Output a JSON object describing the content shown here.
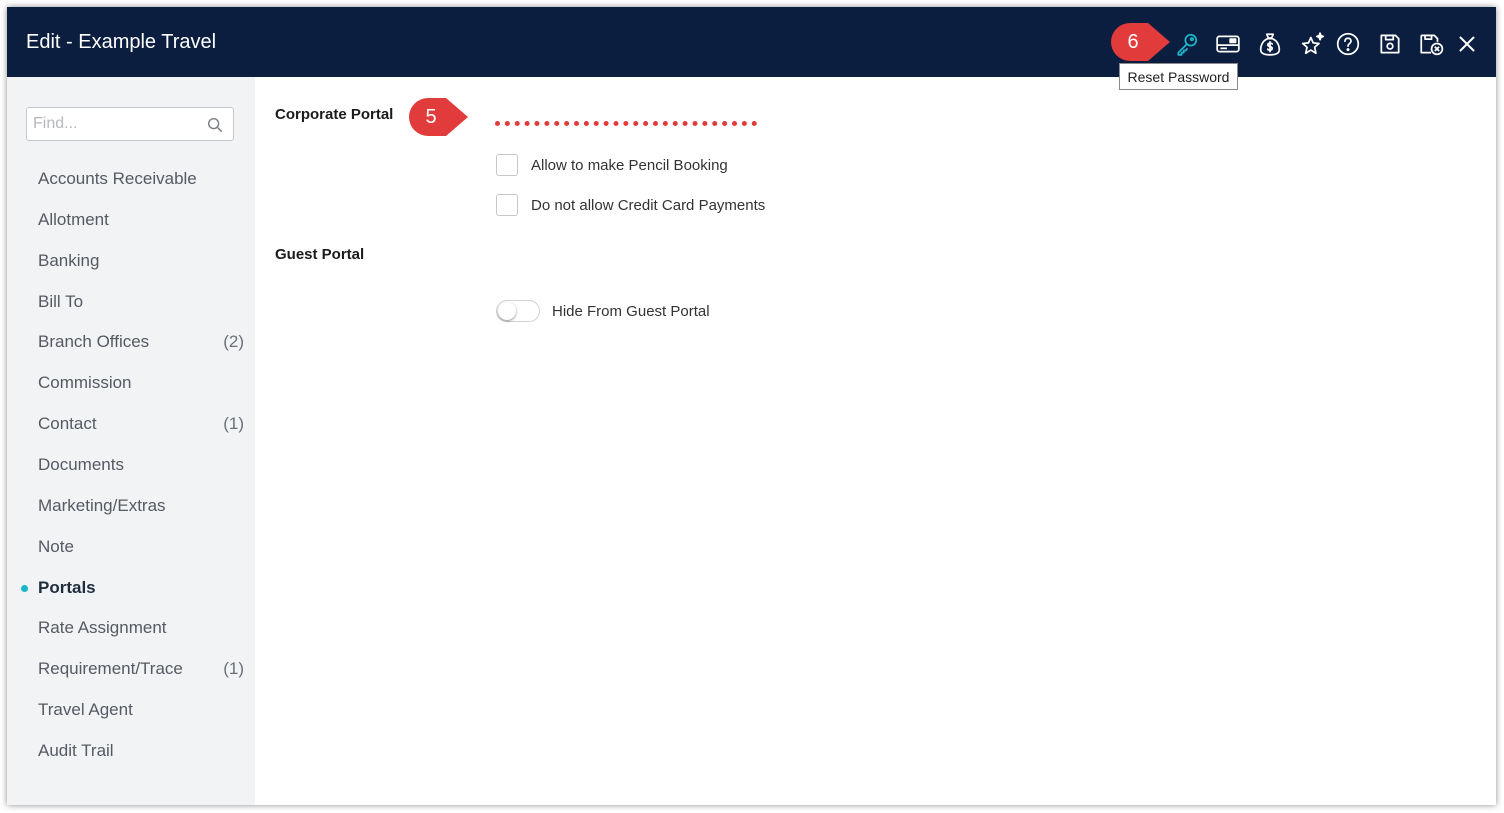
{
  "window": {
    "title": "Edit - Example Travel"
  },
  "toolbar": {
    "icons": [
      {
        "name": "key-icon",
        "tooltip": "Reset Password",
        "color": "#1ab6c9"
      },
      {
        "name": "card-icon"
      },
      {
        "name": "money-bag-icon"
      },
      {
        "name": "stars-icon"
      },
      {
        "name": "help-icon"
      },
      {
        "name": "save-icon"
      },
      {
        "name": "save-close-icon"
      },
      {
        "name": "close-icon"
      }
    ],
    "tooltip": "Reset Password"
  },
  "annotations": {
    "marker_5": "5",
    "marker_6": "6",
    "color": "#e23b3b"
  },
  "sidebar": {
    "search_placeholder": "Find...",
    "items": [
      {
        "label": "Accounts Receivable",
        "count": ""
      },
      {
        "label": "Allotment",
        "count": ""
      },
      {
        "label": "Banking",
        "count": ""
      },
      {
        "label": "Bill To",
        "count": ""
      },
      {
        "label": "Branch Offices",
        "count": "(2)"
      },
      {
        "label": "Commission",
        "count": ""
      },
      {
        "label": "Contact",
        "count": "(1)"
      },
      {
        "label": "Documents",
        "count": ""
      },
      {
        "label": "Marketing/Extras",
        "count": ""
      },
      {
        "label": "Note",
        "count": ""
      },
      {
        "label": "Portals",
        "count": "",
        "active": true
      },
      {
        "label": "Rate Assignment",
        "count": ""
      },
      {
        "label": "Requirement/Trace",
        "count": "(1)"
      },
      {
        "label": "Travel Agent",
        "count": ""
      },
      {
        "label": "Audit Trail",
        "count": ""
      }
    ]
  },
  "corporate_portal": {
    "title": "Corporate Portal",
    "options": [
      {
        "label": "Allow to make Pencil Booking",
        "checked": false
      },
      {
        "label": "Do not allow Credit Card Payments",
        "checked": false
      }
    ]
  },
  "guest_portal": {
    "title": "Guest Portal",
    "toggle_label": "Hide From Guest Portal",
    "toggle_on": false
  }
}
